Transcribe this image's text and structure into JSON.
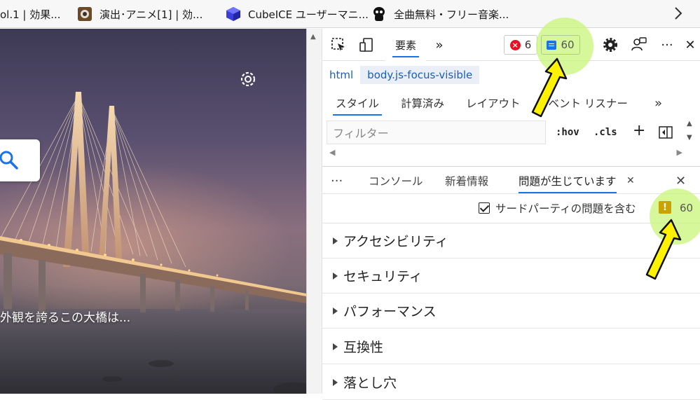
{
  "bookmarks": {
    "items": [
      {
        "label": "ol.1 | 効果...",
        "icon": "page-icon"
      },
      {
        "label": "演出･アニメ[1] | 効...",
        "icon": "speaker-icon"
      },
      {
        "label": "CubeICE ユーザーマニ...",
        "icon": "cube-icon"
      },
      {
        "label": "全曲無料・フリー音楽...",
        "icon": "mascot-icon"
      }
    ],
    "more": "›"
  },
  "page": {
    "caption": "外観を誇るこの大橋は..."
  },
  "devtools": {
    "toolbar": {
      "elements_tab": "要素",
      "more_tabs": "»",
      "error_count": "6",
      "issues_count": "60",
      "more_menu": "···",
      "close": "✕"
    },
    "breadcrumbs": [
      "html",
      "body.js-focus-visible"
    ],
    "style_tabs": [
      "スタイル",
      "計算済み",
      "レイアウト",
      "イベント リスナー",
      "»"
    ],
    "filter": {
      "placeholder": "フィルター",
      "hov": ":hov",
      "cls": ".cls",
      "plus": "+"
    },
    "drawer": {
      "more": "···",
      "tabs": [
        "コンソール",
        "新着情報",
        "問題が生じています"
      ],
      "tab_close": "✕",
      "close": "✕"
    },
    "third_party": {
      "label": "サードパーティの問題を含む",
      "checked": true,
      "warning_count": "60"
    },
    "categories": [
      "アクセシビリティ",
      "セキュリティ",
      "パフォーマンス",
      "互換性",
      "落とし穴"
    ]
  },
  "colors": {
    "accent": "#1a73e8",
    "highlight": "#c8f578",
    "arrow": "#fff200",
    "error": "#e81123",
    "warning": "#c9a300"
  }
}
